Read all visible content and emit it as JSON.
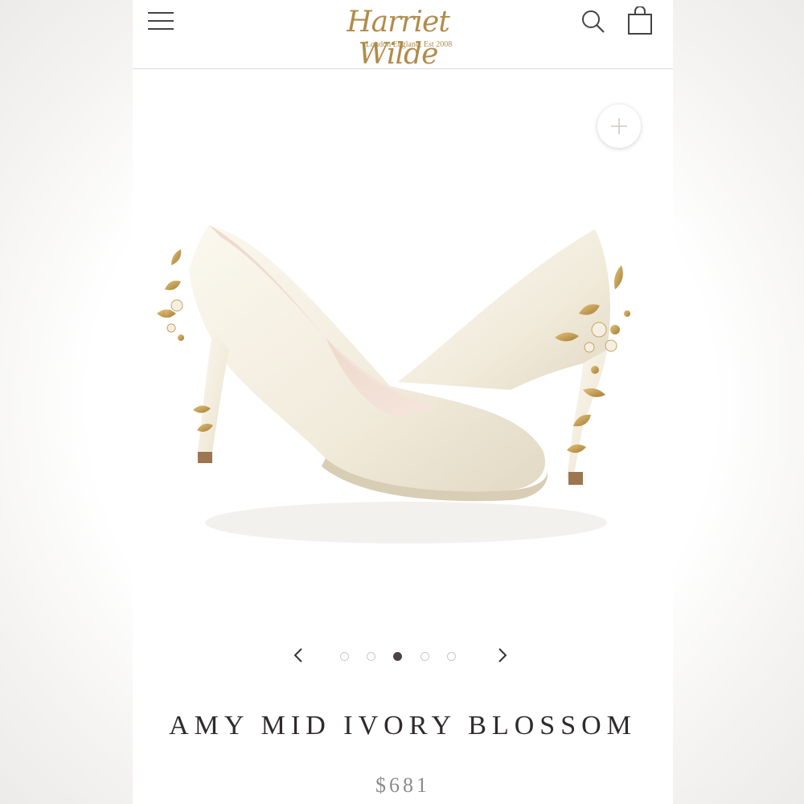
{
  "header": {
    "logo_text": "Harriet Wilde",
    "logo_tagline": "London England, Est 2008",
    "menu_icon": "hamburger-menu-icon",
    "search_icon": "search-icon",
    "bag_icon": "shopping-bag-icon"
  },
  "gallery": {
    "zoom_icon": "plus-icon",
    "image_alt": "Ivory satin mid heel pumps with gold blossom heel detail",
    "prev_icon": "chevron-left-icon",
    "next_icon": "chevron-right-icon",
    "total_images": 5,
    "active_index": 3
  },
  "product": {
    "title": "AMY MID IVORY BLOSSOM",
    "price": "$681"
  },
  "colors": {
    "brand_gold": "#b08c4a",
    "title_text": "#2f2a2c",
    "price_text": "#8d8a8c",
    "active_dot": "#4a4448"
  }
}
